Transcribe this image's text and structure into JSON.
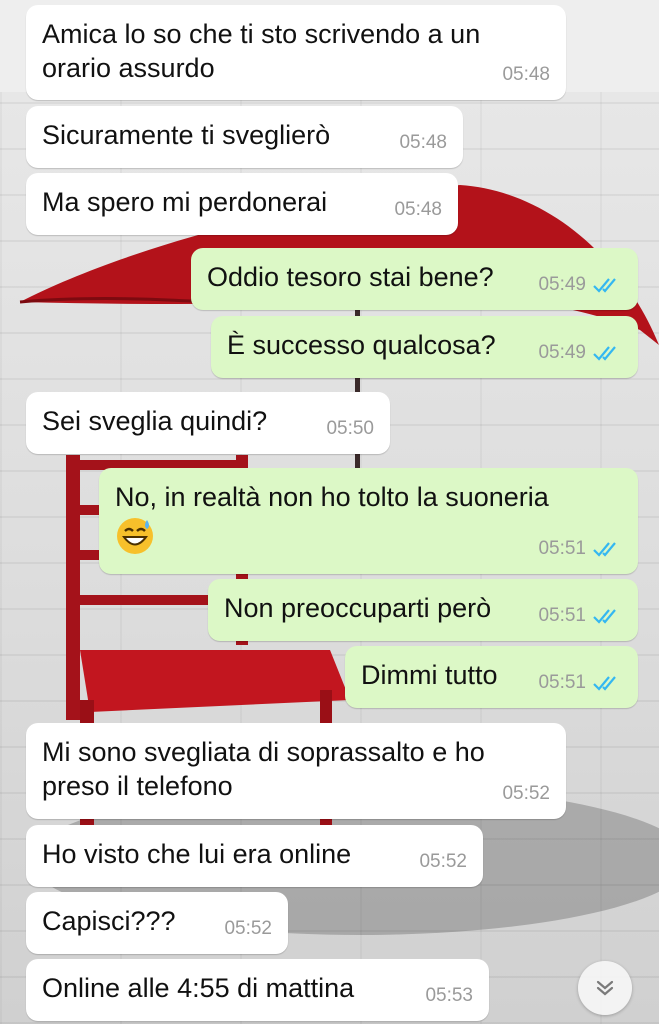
{
  "messages": [
    {
      "text": "Amica lo so che ti sto scrivendo a un\norario assurdo",
      "time": "05:48",
      "direction": "incoming"
    },
    {
      "text": "Sicuramente ti sveglierò",
      "time": "05:48",
      "direction": "incoming"
    },
    {
      "text": "Ma spero mi perdonerai",
      "time": "05:48",
      "direction": "incoming"
    },
    {
      "text": "Oddio tesoro stai bene?",
      "time": "05:49",
      "direction": "outgoing",
      "read": true
    },
    {
      "text": "È successo qualcosa?",
      "time": "05:49",
      "direction": "outgoing",
      "read": true
    },
    {
      "text": "Sei sveglia quindi?",
      "time": "05:50",
      "direction": "incoming"
    },
    {
      "text": "No, in realtà non ho tolto la suoneria",
      "emoji": "grinning-face-with-sweat-emoji",
      "time": "05:51",
      "direction": "outgoing",
      "read": true
    },
    {
      "text": "Non preoccuparti però",
      "time": "05:51",
      "direction": "outgoing",
      "read": true
    },
    {
      "text": "Dimmi tutto",
      "time": "05:51",
      "direction": "outgoing",
      "read": true
    },
    {
      "text": "Mi sono svegliata di soprassalto e ho\npreso il telefono",
      "time": "05:52",
      "direction": "incoming"
    },
    {
      "text": "Ho visto che lui era online",
      "time": "05:52",
      "direction": "incoming"
    },
    {
      "text": "Capisci???",
      "time": "05:52",
      "direction": "incoming"
    },
    {
      "text": "Online alle 4:55 di mattina",
      "time": "05:53",
      "direction": "incoming"
    }
  ],
  "colors": {
    "incoming_bubble": "#ffffff",
    "outgoing_bubble": "#dcf8c6",
    "read_ticks": "#34b7f1",
    "timestamp": "#9a9a9a"
  },
  "icons": {
    "read_receipt": "double-check-icon",
    "scroll_button": "chevron-down-icon"
  }
}
